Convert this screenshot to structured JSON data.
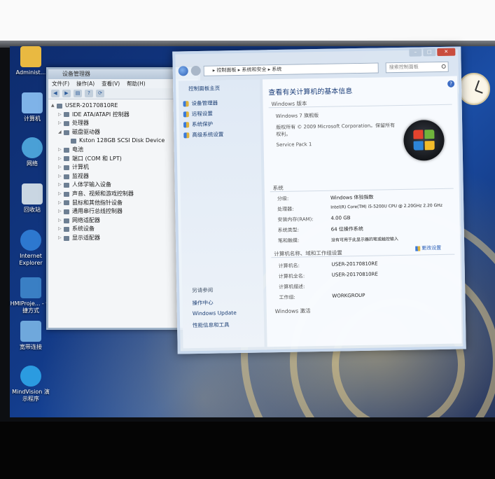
{
  "desktop": {
    "icons": [
      {
        "label": "Administ...",
        "icon": "user-folder-icon",
        "color": "#e9b941"
      },
      {
        "label": "计算机",
        "icon": "computer-icon",
        "color": "#7fb3e8"
      },
      {
        "label": "网络",
        "icon": "network-icon",
        "color": "#4aa0d6"
      },
      {
        "label": "回收站",
        "icon": "recycle-bin-icon",
        "color": "#c9d6e2"
      },
      {
        "label": "Internet Explorer",
        "icon": "internet-explorer-icon",
        "color": "#2d78cf"
      },
      {
        "label": "HMIProje... - 快捷方式",
        "icon": "hmi-project-icon",
        "color": "#3a7fc4"
      },
      {
        "label": "宽带连接",
        "icon": "broadband-connection-icon",
        "color": "#6fa8dc"
      },
      {
        "label": "MindVision 演示程序",
        "icon": "mindvision-icon",
        "color": "#2b9be0"
      }
    ]
  },
  "device_manager": {
    "title": "设备管理器",
    "menu": [
      "文件(F)",
      "操作(A)",
      "查看(V)",
      "帮助(H)"
    ],
    "toolbar_icons": [
      "back-icon",
      "forward-icon",
      "properties-icon",
      "help-icon",
      "scan-icon"
    ],
    "tree": [
      {
        "label": "USER-20170810RE",
        "indent": 0,
        "exp": "▲"
      },
      {
        "label": "IDE ATA/ATAPI 控制器",
        "indent": 1,
        "exp": "▷"
      },
      {
        "label": "处理器",
        "indent": 1,
        "exp": "▷"
      },
      {
        "label": "磁盘驱动器",
        "indent": 1,
        "exp": "◢"
      },
      {
        "label": "Kston 128GB SCSI Disk Device",
        "indent": 2,
        "exp": ""
      },
      {
        "label": "电池",
        "indent": 1,
        "exp": "▷"
      },
      {
        "label": "端口 (COM 和 LPT)",
        "indent": 1,
        "exp": "▷"
      },
      {
        "label": "计算机",
        "indent": 1,
        "exp": "▷"
      },
      {
        "label": "监视器",
        "indent": 1,
        "exp": "▷"
      },
      {
        "label": "人体学输入设备",
        "indent": 1,
        "exp": "▷"
      },
      {
        "label": "声音、视频和游戏控制器",
        "indent": 1,
        "exp": "▷"
      },
      {
        "label": "鼠标和其他指针设备",
        "indent": 1,
        "exp": "▷"
      },
      {
        "label": "通用串行总线控制器",
        "indent": 1,
        "exp": "▷"
      },
      {
        "label": "网络适配器",
        "indent": 1,
        "exp": "▷"
      },
      {
        "label": "系统设备",
        "indent": 1,
        "exp": "▷"
      },
      {
        "label": "显示适配器",
        "indent": 1,
        "exp": "▷"
      }
    ]
  },
  "system_window": {
    "breadcrumb": "▸ 控制面板 ▸ 系统和安全 ▸ 系统",
    "search_placeholder": "搜索控制面板",
    "left_pane": {
      "home": "控制面板主页",
      "links": [
        "设备管理器",
        "远程设置",
        "系统保护",
        "高级系统设置"
      ],
      "see_also_title": "另请参阅",
      "see_also": [
        "操作中心",
        "Windows Update",
        "性能信息和工具"
      ]
    },
    "main": {
      "title": "查看有关计算机的基本信息",
      "edition_section": "Windows 版本",
      "edition": "Windows 7 旗舰版",
      "copyright": "版权所有 © 2009 Microsoft Corporation。保留所有权利。",
      "service_pack": "Service Pack 1",
      "system_section": "系统",
      "rows": [
        {
          "k": "分级:",
          "v": "Windows 体验指数"
        },
        {
          "k": "处理器:",
          "v": "Intel(R) Core(TM) i5-5200U CPU @ 2.20GHz 2.20 GHz"
        },
        {
          "k": "安装内存(RAM):",
          "v": "4.00 GB"
        },
        {
          "k": "系统类型:",
          "v": "64 位操作系统"
        },
        {
          "k": "笔和触摸:",
          "v": "没有可用于此显示器的笔或触控输入"
        }
      ],
      "computer_section": "计算机名称、域和工作组设置",
      "computer_rows": [
        {
          "k": "计算机名:",
          "v": "USER-20170810RE"
        },
        {
          "k": "计算机全名:",
          "v": "USER-20170810RE"
        },
        {
          "k": "计算机描述:",
          "v": ""
        },
        {
          "k": "工作组:",
          "v": "WORKGROUP"
        }
      ],
      "change_settings": "更改设置",
      "activation_section": "Windows 激活"
    }
  },
  "colors": {
    "accent_link": "#2b5fb8",
    "title_blue": "#1d3f7a"
  }
}
